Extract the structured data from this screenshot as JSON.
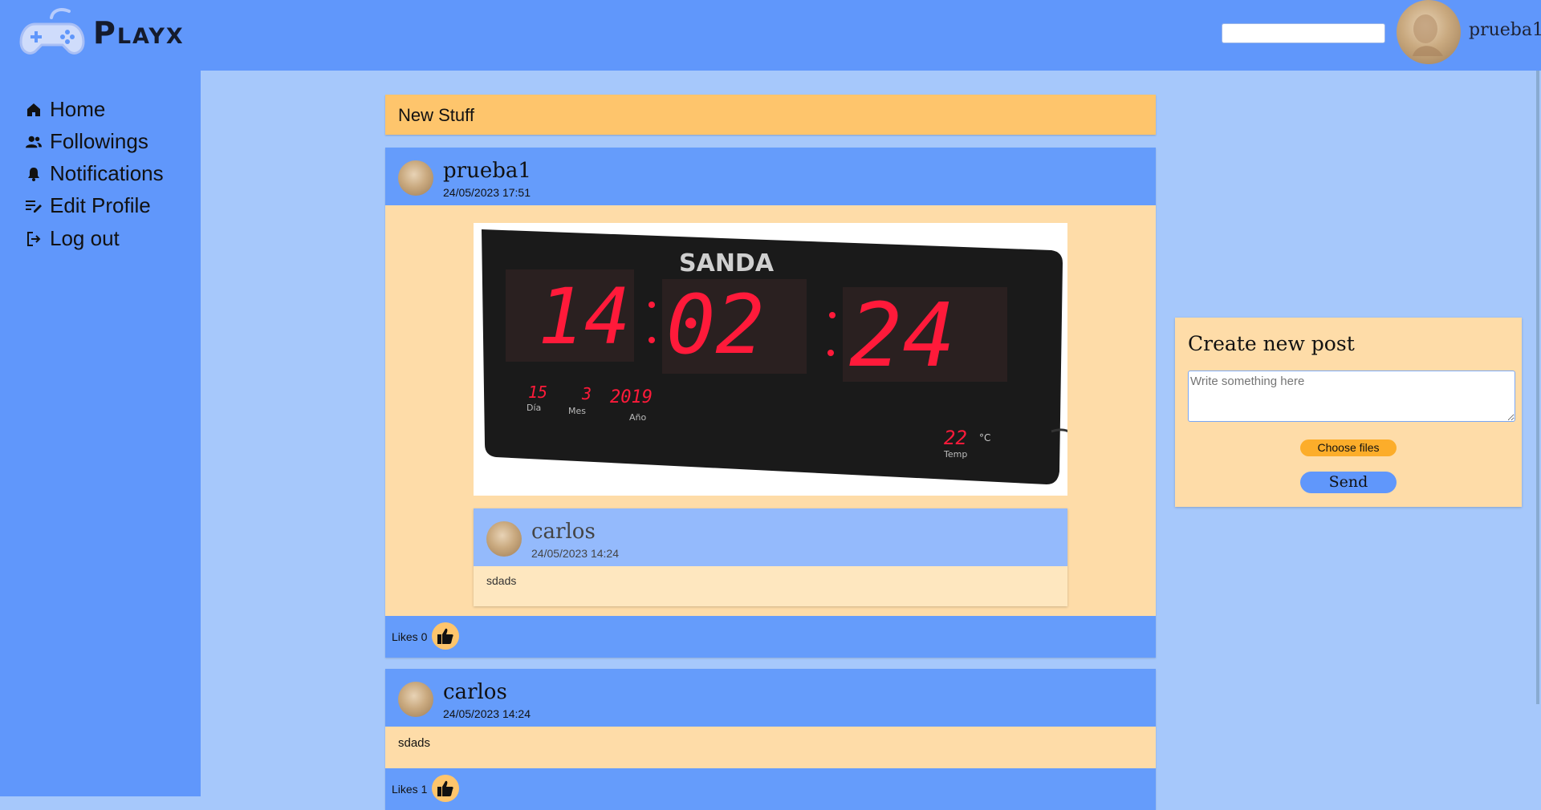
{
  "app": {
    "name": "Playx",
    "logo_icon": "gamepad-icon"
  },
  "header": {
    "search_placeholder": "",
    "username": "prueba1",
    "avatar_icon": "user-avatar"
  },
  "sidebar": {
    "items": [
      {
        "label": "Home",
        "icon": "home-icon"
      },
      {
        "label": "Followings",
        "icon": "users-icon"
      },
      {
        "label": "Notifications",
        "icon": "bell-icon"
      },
      {
        "label": "Edit Profile",
        "icon": "edit-icon"
      },
      {
        "label": "Log out",
        "icon": "logout-icon"
      }
    ]
  },
  "feed": {
    "header": "New Stuff",
    "posts": [
      {
        "author": "prueba1",
        "date": "24/05/2023 17:51",
        "image": {
          "brand": "SANDA",
          "hours": "14",
          "minutes": "02",
          "seconds": "24",
          "day": "15",
          "month": "3",
          "year": "2019",
          "day_label": "Día",
          "month_label": "Mes",
          "year_label": "Año",
          "temp": "22",
          "temp_unit": "°C",
          "temp_label": "Temp"
        },
        "quoted": {
          "author": "carlos",
          "date": "24/05/2023 14:24",
          "text": "sdads"
        },
        "likes_label": "Likes 0"
      },
      {
        "author": "carlos",
        "date": "24/05/2023 14:24",
        "text": "sdads",
        "likes_label": "Likes 1"
      }
    ]
  },
  "create_post": {
    "title": "Create new post",
    "placeholder": "Write something here",
    "choose_files": "Choose files",
    "send": "Send"
  },
  "colors": {
    "topbar": "#6097fb",
    "background": "#a6c8fb",
    "header_accent": "#fec56c",
    "post_body": "#fedca8"
  }
}
